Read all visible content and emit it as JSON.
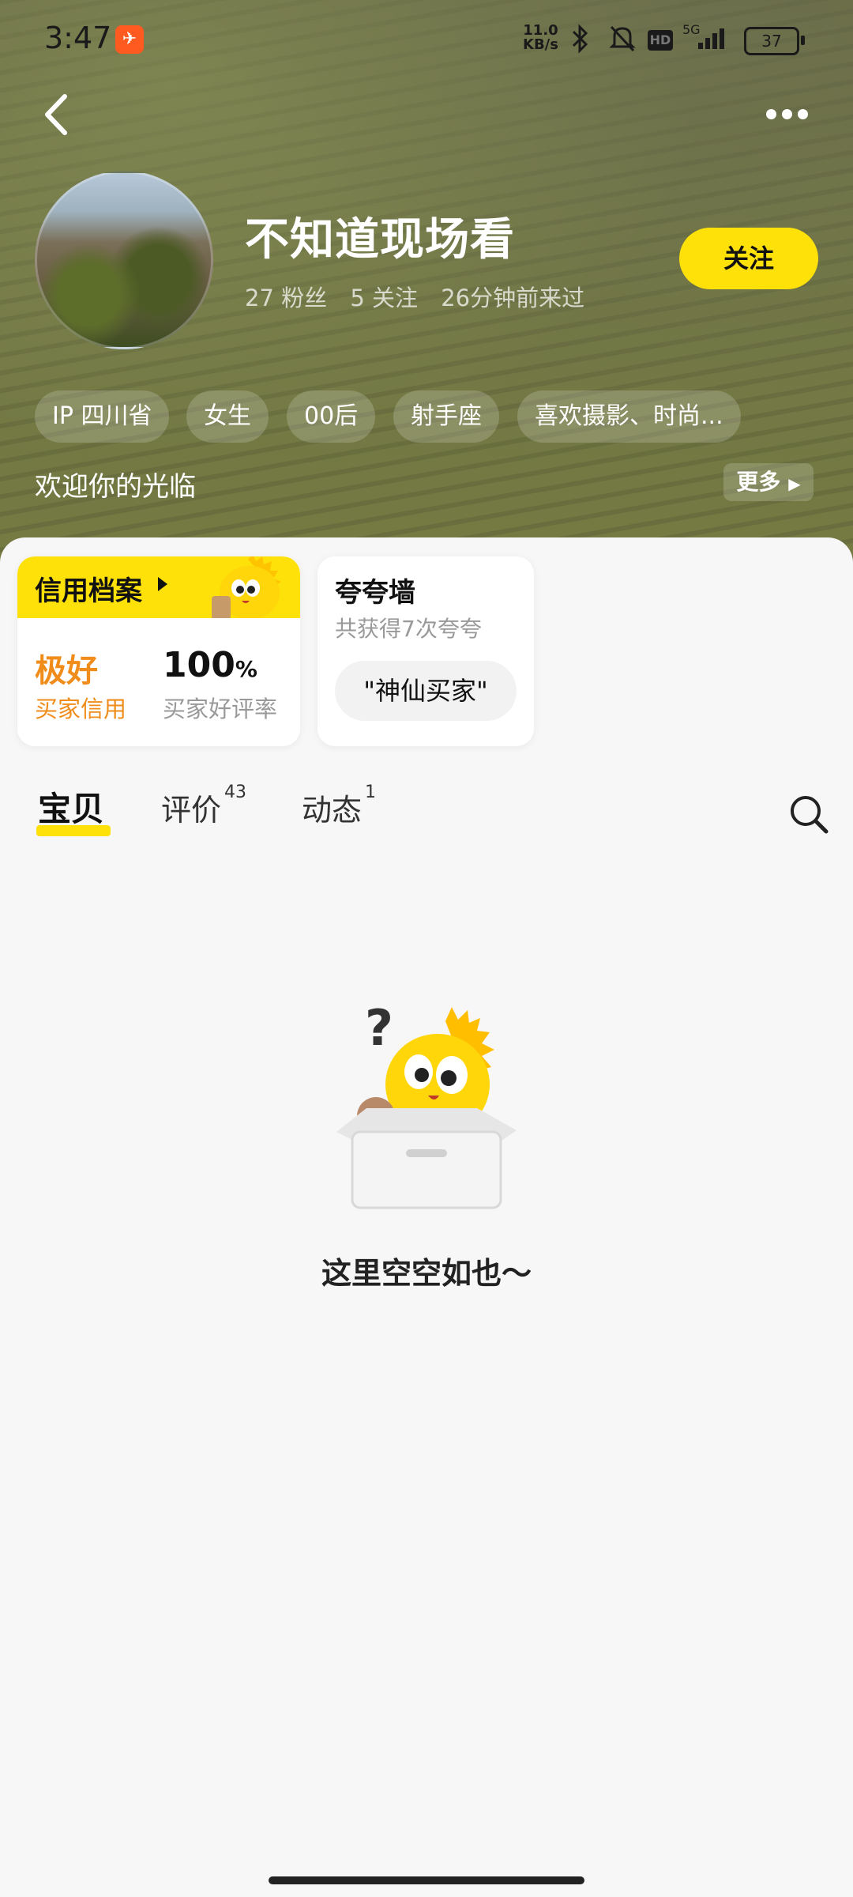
{
  "status_bar": {
    "time": "3:47",
    "net_speed_value": "11.0",
    "net_speed_unit": "KB/s",
    "network": "5G",
    "battery": "37"
  },
  "profile": {
    "username": "不知道现场看",
    "followers": "27 粉丝",
    "following": "5 关注",
    "last_seen": "26分钟前来过",
    "follow_label": "关注",
    "tags": [
      "IP 四川省",
      "女生",
      "00后",
      "射手座",
      "喜欢摄影、时尚..."
    ],
    "welcome": "欢迎你的光临",
    "more_label": "更多"
  },
  "credit": {
    "title": "信用档案",
    "level": "极好",
    "level_label": "买家信用",
    "rate": "100",
    "rate_unit": "%",
    "rate_label": "买家好评率"
  },
  "praise": {
    "title": "夸夸墙",
    "subtitle": "共获得7次夸夸",
    "badge": "\"神仙买家\""
  },
  "tabs": [
    {
      "label": "宝贝",
      "count": ""
    },
    {
      "label": "评价",
      "count": "43"
    },
    {
      "label": "动态",
      "count": "1"
    }
  ],
  "empty_state": {
    "text": "这里空空如也～"
  },
  "colors": {
    "accent": "#ffe10a",
    "credit_orange": "#f08c1a"
  }
}
